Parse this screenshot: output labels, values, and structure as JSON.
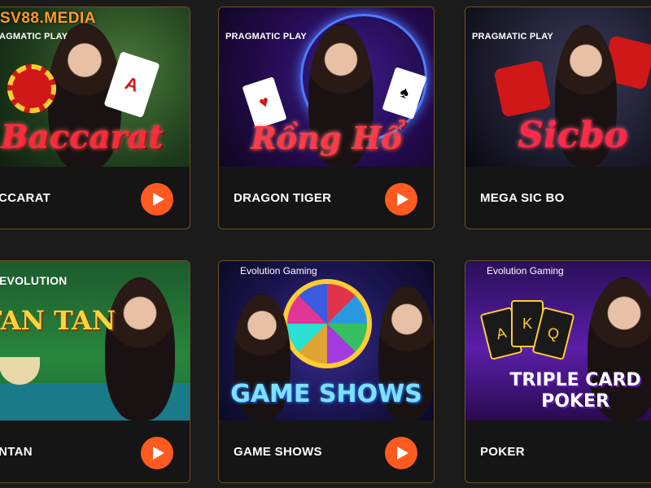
{
  "watermark": "SV88.MEDIA",
  "colors": {
    "accent": "#ff5a1f",
    "card_border": "#6a5326",
    "background": "#1b1b1b"
  },
  "games": [
    {
      "name": "ACCARAT",
      "provider": "AGMATIC PLAY",
      "art_title": "Baccarat",
      "icon": "play-icon"
    },
    {
      "name": "DRAGON TIGER",
      "provider": "PRAGMATIC PLAY",
      "art_title": "Rồng Hổ",
      "icon": "play-icon"
    },
    {
      "name": "MEGA SIC BO",
      "provider": "PRAGMATIC PLAY",
      "art_title": "Sicbo",
      "icon": "play-icon"
    },
    {
      "name": "ANTAN",
      "provider": "EVOLUTION",
      "art_title": "FAN TAN",
      "icon": "play-icon"
    },
    {
      "name": "GAME SHOWS",
      "provider": "Evolution Gaming",
      "art_title": "GAME SHOWS",
      "icon": "play-icon"
    },
    {
      "name": "POKER",
      "provider": "Evolution Gaming",
      "art_title": "TRIPLE CARD POKER",
      "icon": "play-icon"
    }
  ]
}
